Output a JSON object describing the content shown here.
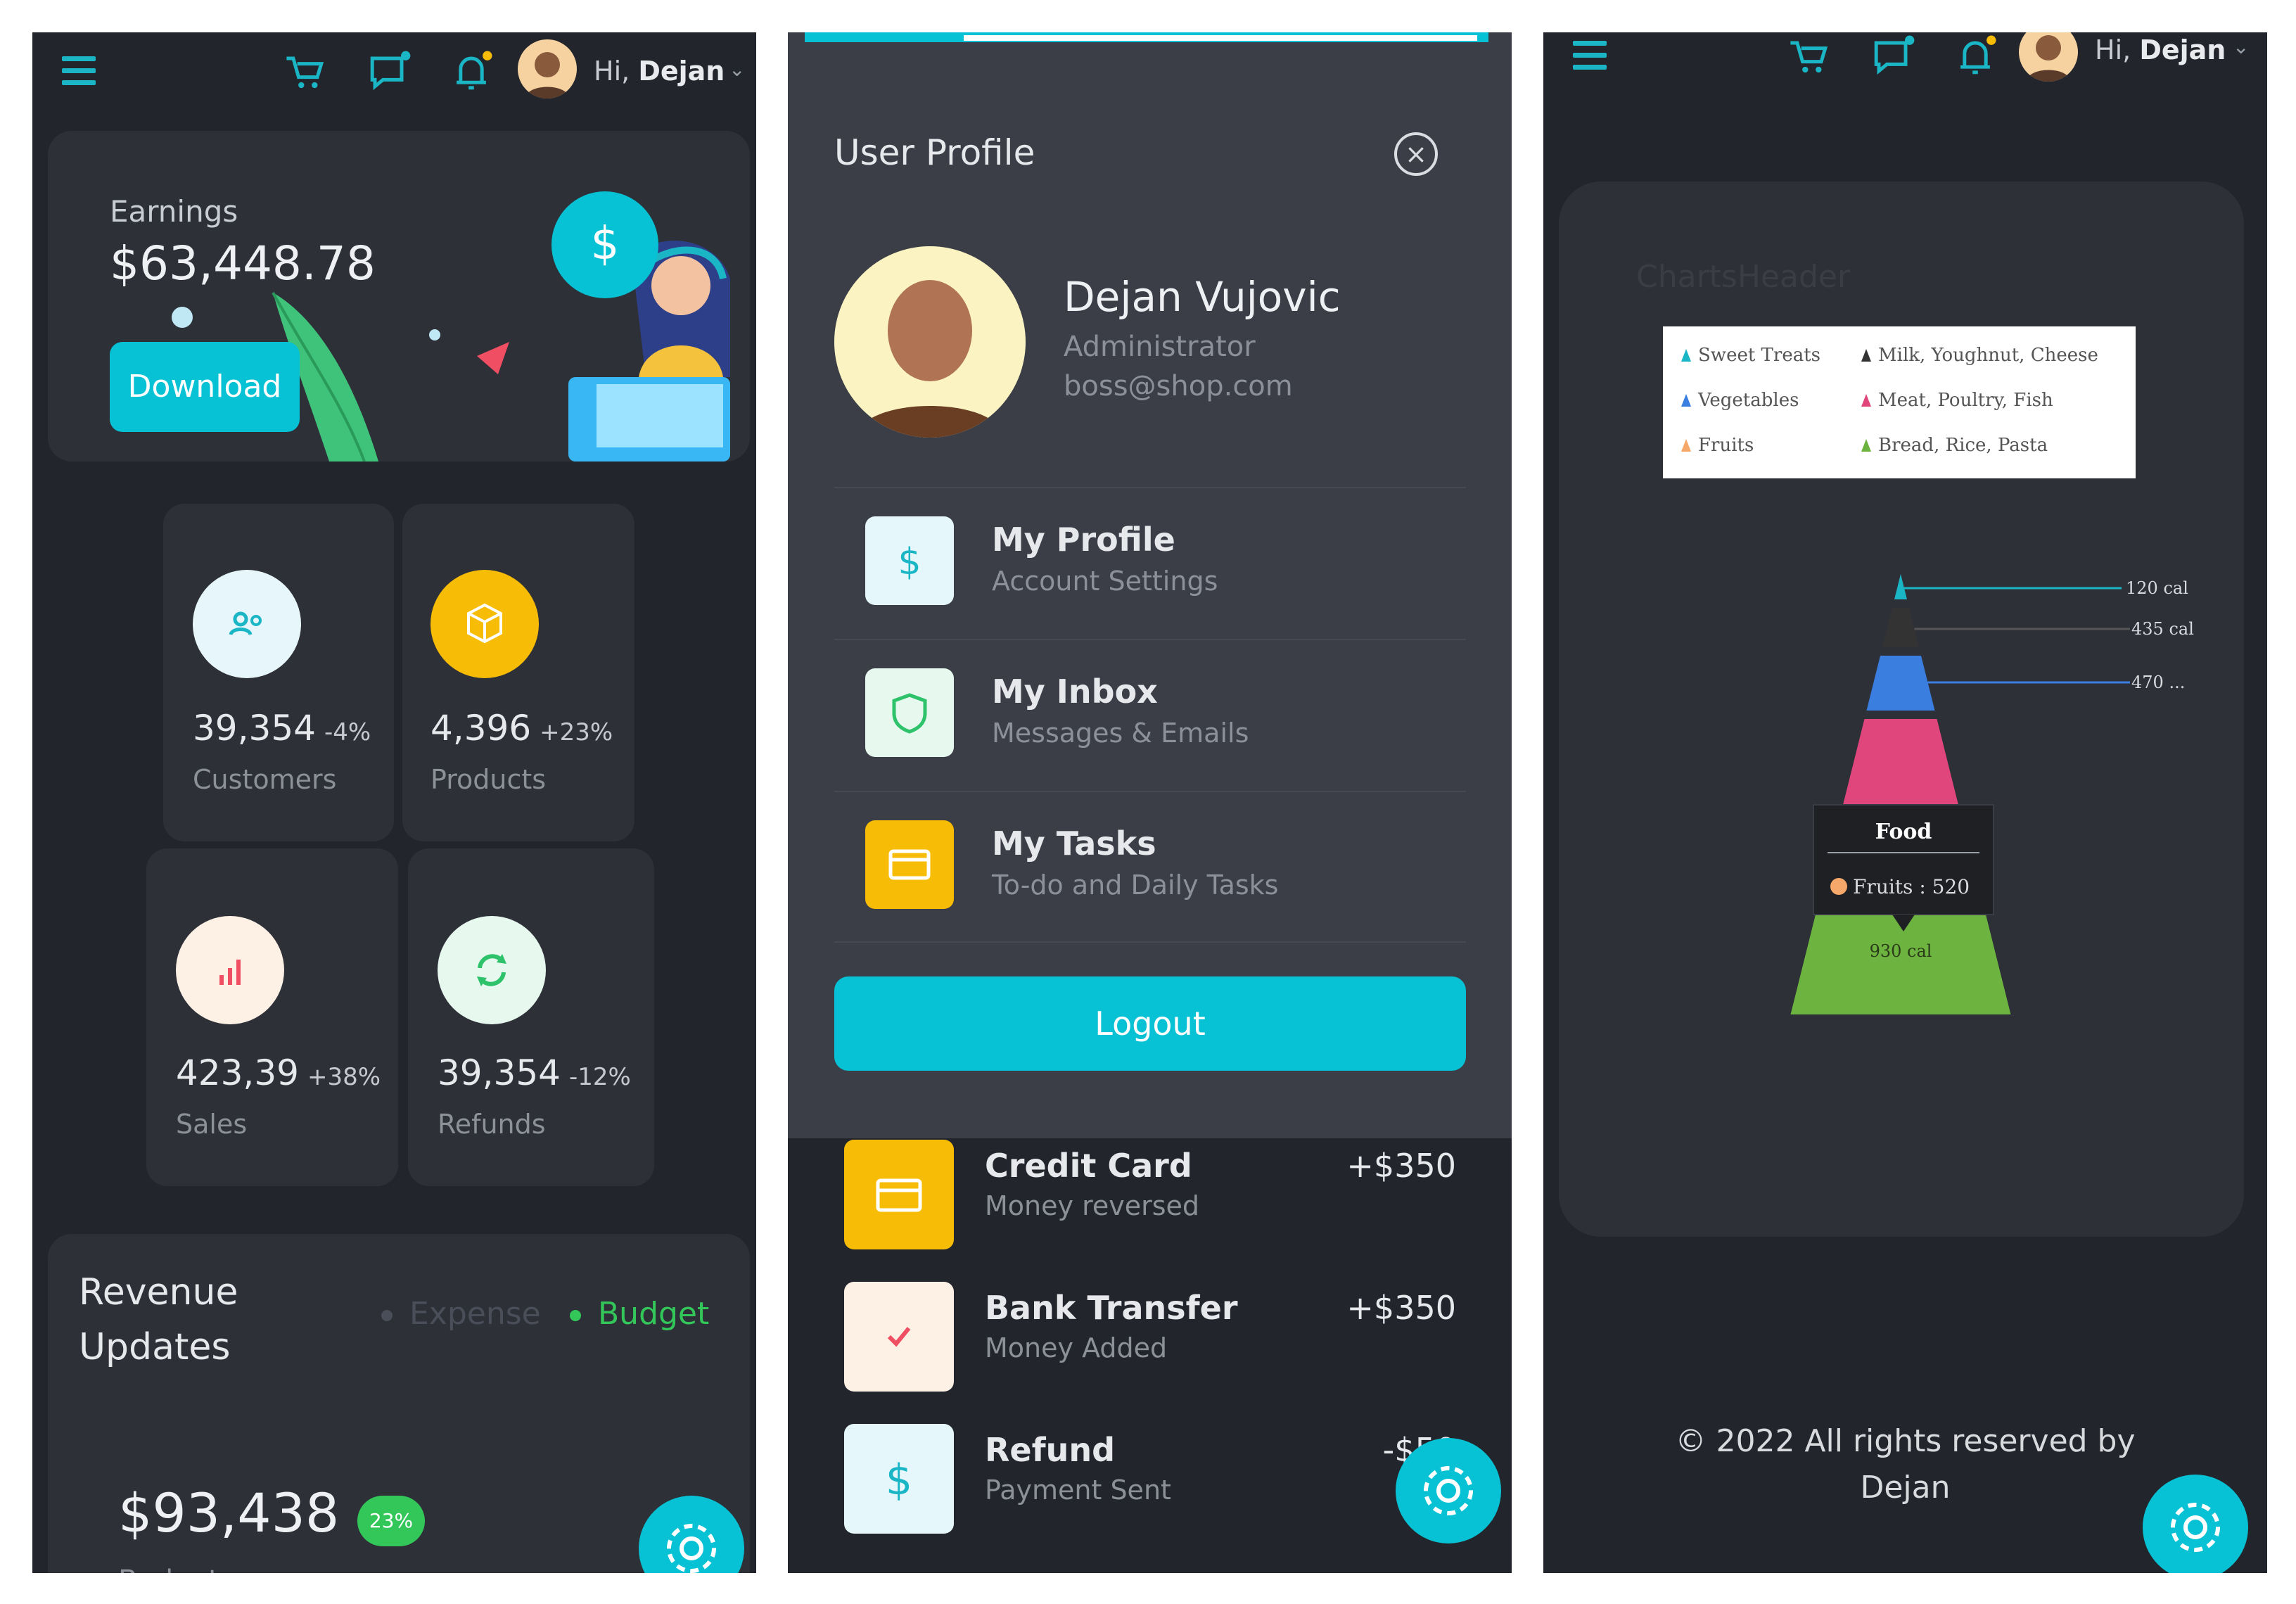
{
  "colors": {
    "accent": "#07c2d4",
    "background": "#23252c",
    "card": "#2e3038",
    "budget": "#33c75a",
    "yellow": "#f7bc05"
  },
  "header": {
    "greeting": "Hi,",
    "user": "Dejan"
  },
  "earnings": {
    "label": "Earnings",
    "value": "$63,448.78",
    "button": "Download"
  },
  "stats": [
    {
      "value": "39,354",
      "change": "-4%",
      "label": "Customers",
      "icon": "users-icon"
    },
    {
      "value": "4,396",
      "change": "+23%",
      "label": "Products",
      "icon": "box-icon"
    },
    {
      "value": "423,39",
      "change": "+38%",
      "label": "Sales",
      "icon": "bar-chart-icon"
    },
    {
      "value": "39,354",
      "change": "-12%",
      "label": "Refunds",
      "icon": "refresh-icon"
    }
  ],
  "revenue": {
    "title_line1": "Revenue",
    "title_line2": "Updates",
    "legend_expense": "Expense",
    "legend_budget": "Budget",
    "amount": "$93,438",
    "badge": "23%",
    "sub": "Budget"
  },
  "profile": {
    "title": "User Profile",
    "name": "Dejan Vujovic",
    "role": "Administrator",
    "email": "boss@shop.com",
    "menu": [
      {
        "title": "My Profile",
        "sub": "Account Settings",
        "icon": "dollar-icon"
      },
      {
        "title": "My Inbox",
        "sub": "Messages & Emails",
        "icon": "shield-icon"
      },
      {
        "title": "My Tasks",
        "sub": "To-do and Daily Tasks",
        "icon": "card-icon"
      }
    ],
    "logout": "Logout"
  },
  "transactions": [
    {
      "title": "Credit Card",
      "sub": "Money reversed",
      "amount": "+$350",
      "icon": "card-icon"
    },
    {
      "title": "Bank Transfer",
      "sub": "Money Added",
      "amount": "+$350",
      "icon": "check-icon"
    },
    {
      "title": "Refund",
      "sub": "Payment Sent",
      "amount": "-$50",
      "icon": "dollar-icon"
    }
  ],
  "chart_header": "ChartsHeader",
  "chart_data": {
    "type": "pyramid",
    "legend": [
      "Sweet Treats",
      "Milk, Youghnut, Cheese",
      "Vegetables",
      "Meat, Poultry, Fish",
      "Fruits",
      "Bread, Rice, Pasta"
    ],
    "levels": [
      {
        "name": "Sweet Treats",
        "value": 120,
        "label": "120 cal",
        "color": "#1ab6c5"
      },
      {
        "name": "Milk, Youghnut, Cheese",
        "value": 435,
        "label": "435 cal",
        "color": "#333333"
      },
      {
        "name": "Vegetables",
        "value": 470,
        "label": "470 ...",
        "color": "#3a7ee0"
      },
      {
        "name": "Meat, Poultry, Fish",
        "value": null,
        "color": "#e0457b"
      },
      {
        "name": "Fruits",
        "value": 520,
        "label": "520 cal",
        "color": "#f5a86a"
      },
      {
        "name": "Bread, Rice, Pasta",
        "value": 930,
        "label": "930 cal",
        "color": "#6db33f"
      }
    ],
    "tooltip": {
      "title": "Food",
      "series": "Fruits",
      "value": "520"
    }
  },
  "footer": {
    "line1": "© 2022 All rights reserved by",
    "line2": "Dejan"
  }
}
